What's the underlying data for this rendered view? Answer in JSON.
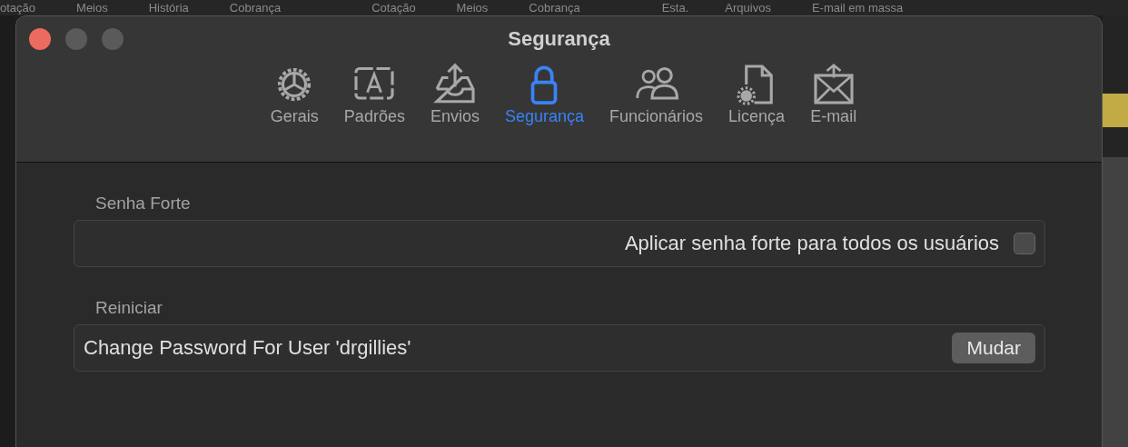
{
  "background_menu": [
    "otação",
    "Meios",
    "História",
    "Cobrança",
    "Cotação",
    "Meios",
    "Cobrança",
    "Esta.",
    "Arquivos",
    "E-mail em massa"
  ],
  "window": {
    "title": "Segurança"
  },
  "tabs": [
    {
      "label": "Gerais",
      "kind": "gear",
      "selected": false
    },
    {
      "label": "Padrões",
      "kind": "font",
      "selected": false
    },
    {
      "label": "Envios",
      "kind": "outbox",
      "selected": false
    },
    {
      "label": "Segurança",
      "kind": "lock",
      "selected": true
    },
    {
      "label": "Funcionários",
      "kind": "people",
      "selected": false
    },
    {
      "label": "Licença",
      "kind": "license",
      "selected": false
    },
    {
      "label": "E-mail",
      "kind": "mail",
      "selected": false
    }
  ],
  "sections": [
    {
      "title": "Senha Forte",
      "kind": "checkbox",
      "label": "Aplicar senha forte para todos os usuários",
      "checked": false
    },
    {
      "title": "Reiniciar",
      "kind": "button",
      "label": "Change Password For User 'drgillies'",
      "button": "Mudar"
    }
  ]
}
